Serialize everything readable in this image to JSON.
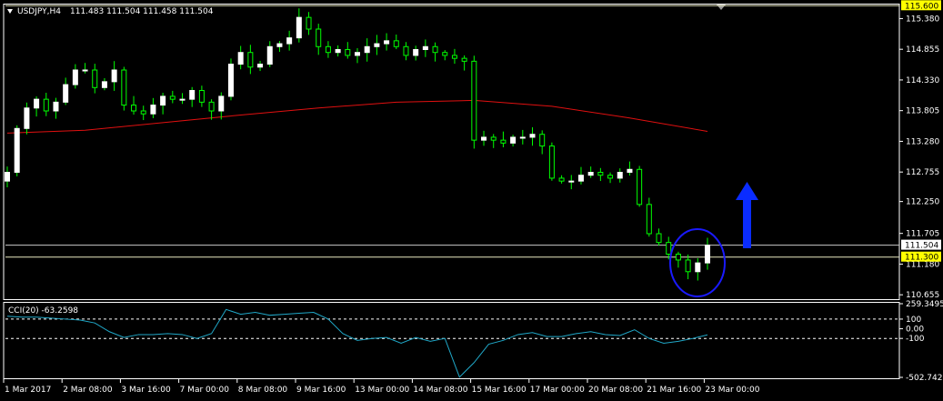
{
  "header": {
    "symbol": "USDJPY,H4",
    "ohlc": "111.483 111.504 111.458 111.504"
  },
  "indicator": {
    "label": "CCI(20) -63.2598"
  },
  "colors": {
    "bull": "#ffffff",
    "bear": "#00ff00",
    "ma": "#e01010",
    "cci": "#20a8c8",
    "circle": "#1a1aff",
    "arrow": "#0a2cff",
    "hline1": "#c8c8c8",
    "hline2": "#e8e8c0",
    "tag_bg": "#ffff00"
  },
  "chart_data": [
    {
      "type": "candlestick",
      "symbol": "USDJPY",
      "timeframe": "H4",
      "ylim": [
        110.58,
        115.62
      ],
      "y_ticks": [
        "115.380",
        "114.855",
        "114.330",
        "113.805",
        "113.280",
        "112.755",
        "112.250",
        "111.705",
        "111.180",
        "110.655"
      ],
      "price_tags": [
        "115.600",
        "111.504",
        "111.300"
      ],
      "x_ticks": [
        "1 Mar 2017",
        "2 Mar 08:00",
        "3 Mar 16:00",
        "7 Mar 00:00",
        "8 Mar 08:00",
        "9 Mar 16:00",
        "13 Mar 00:00",
        "14 Mar 08:00",
        "15 Mar 16:00",
        "17 Mar 00:00",
        "20 Mar 08:00",
        "21 Mar 16:00",
        "23 Mar 00:00"
      ],
      "hlines": [
        115.6,
        111.504,
        111.3
      ],
      "ma_approx": [
        [
          0,
          113.42
        ],
        [
          20,
          113.47
        ],
        [
          40,
          113.6
        ],
        [
          60,
          113.73
        ],
        [
          80,
          113.85
        ],
        [
          100,
          113.95
        ],
        [
          120,
          113.98
        ],
        [
          140,
          113.88
        ],
        [
          160,
          113.68
        ],
        [
          180,
          113.45
        ]
      ],
      "closes_approx": [
        112.75,
        113.5,
        113.85,
        114.0,
        113.8,
        113.95,
        114.25,
        114.5,
        114.5,
        114.2,
        114.3,
        114.5,
        113.9,
        113.8,
        113.75,
        113.9,
        114.05,
        114.0,
        114.0,
        114.15,
        113.95,
        113.8,
        114.05,
        114.6,
        114.8,
        114.55,
        114.6,
        114.9,
        114.95,
        115.05,
        115.4,
        115.2,
        114.9,
        114.8,
        114.85,
        114.75,
        114.8,
        114.9,
        114.95,
        115.0,
        114.9,
        114.75,
        114.85,
        114.9,
        114.8,
        114.75,
        114.7,
        114.65,
        113.3,
        113.35,
        113.3,
        113.25,
        113.35,
        113.35,
        113.4,
        113.2,
        112.65,
        112.6,
        112.6,
        112.7,
        112.75,
        112.7,
        112.65,
        112.75,
        112.8,
        112.2,
        111.7,
        111.55,
        111.35,
        111.25,
        111.05,
        111.2,
        111.504
      ]
    },
    {
      "type": "line",
      "name": "CCI(20)",
      "value": -63.2598,
      "ylim": [
        -502.7421,
        259.3495
      ],
      "y_ticks": [
        "259.3495",
        "100",
        "0.00",
        "-100",
        "-502.7421"
      ],
      "levels": [
        100,
        -100
      ],
      "values_approx": [
        130,
        120,
        120,
        110,
        100,
        90,
        60,
        -30,
        -90,
        -60,
        -60,
        -50,
        -60,
        -100,
        -50,
        200,
        150,
        170,
        140,
        150,
        160,
        170,
        100,
        -50,
        -120,
        -100,
        -90,
        -150,
        -90,
        -130,
        -100,
        -500,
        -350,
        -160,
        -120,
        -60,
        -40,
        -80,
        -80,
        -50,
        -30,
        -60,
        -70,
        -10,
        -100,
        -150,
        -130,
        -100,
        -63.26
      ]
    }
  ]
}
